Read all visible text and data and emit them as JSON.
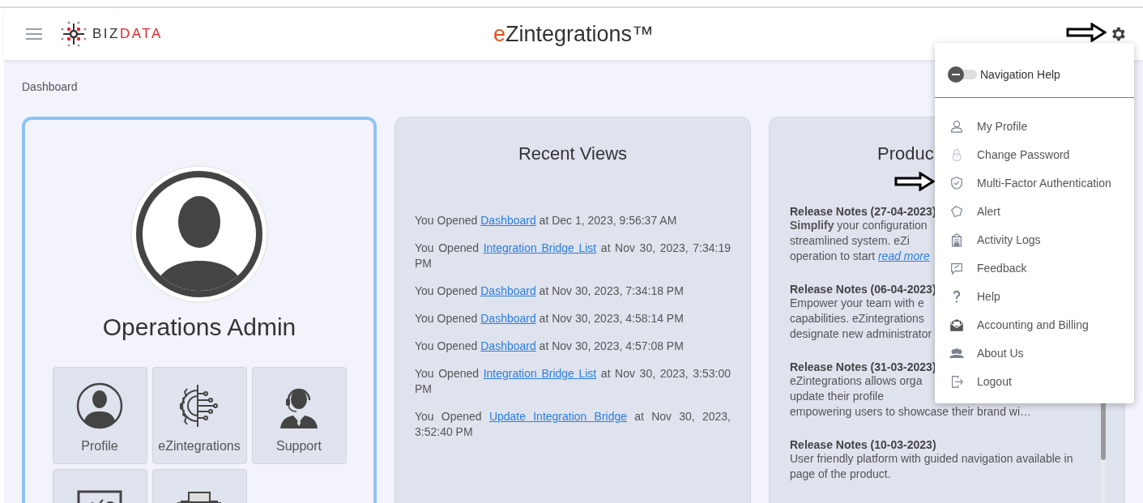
{
  "header": {
    "logo_text": "BIZDATA",
    "brand": "eZintegrations™"
  },
  "breadcrumb": "Dashboard",
  "profile_card": {
    "name": "Operations Admin",
    "tiles": [
      {
        "kind": "profile",
        "label": "Profile"
      },
      {
        "kind": "integrations",
        "label": "eZintegrations"
      },
      {
        "kind": "support",
        "label": "Support"
      },
      {
        "kind": "chart"
      },
      {
        "kind": "market"
      }
    ]
  },
  "recent_views": {
    "title": "Recent Views",
    "items": [
      {
        "prefix": "You Opened ",
        "link": "Dashboard",
        "suffix": " at Dec 1, 2023, 9:56:37 AM"
      },
      {
        "prefix": "You Opened ",
        "link": "Integration Bridge List",
        "suffix": " at Nov 30, 2023, 7:34:19 PM"
      },
      {
        "prefix": "You Opened ",
        "link": "Dashboard",
        "suffix": " at Nov 30, 2023, 7:34:18 PM"
      },
      {
        "prefix": "You Opened ",
        "link": "Dashboard",
        "suffix": " at Nov 30, 2023, 4:58:14 PM"
      },
      {
        "prefix": "You Opened ",
        "link": "Dashboard",
        "suffix": " at Nov 30, 2023, 4:57:08 PM"
      },
      {
        "prefix": "You Opened ",
        "link": "Integration Bridge List",
        "suffix": " at Nov 30, 2023, 3:53:00 PM"
      },
      {
        "prefix": "You Opened ",
        "link": "Update Integration Bridge",
        "suffix": " at Nov 30, 2023, 3:52:40 PM"
      }
    ]
  },
  "product_card": {
    "title": "Produc",
    "notes": [
      {
        "title": "Release Notes (27-04-2023)",
        "lines": [
          {
            "text": "**Simplify** your configuration"
          },
          {
            "text": "streamlined system. eZi"
          },
          {
            "text": "operation to start ",
            "link": "read more"
          }
        ]
      },
      {
        "title": "Release Notes (06-04-2023)",
        "lines": [
          {
            "text": "Empower your team with e"
          },
          {
            "text": "capabilities. eZintegrations"
          },
          {
            "text": "designate new administrator"
          }
        ]
      },
      {
        "title": "Release Notes (31-03-2023)",
        "lines": [
          {
            "text": "eZintegrations allows orga"
          },
          {
            "text": "update their profile"
          },
          {
            "text": "empowering users to showcase their brand wi…"
          }
        ]
      },
      {
        "title": "Release Notes (10-03-2023)",
        "lines": [
          {
            "text": "User friendly platform with guided navigation available in page of the product."
          }
        ]
      }
    ]
  },
  "settings_menu": {
    "navigation_help": {
      "label": "Navigation Help",
      "on": false
    },
    "items": [
      {
        "kind": "profile",
        "label": "My Profile"
      },
      {
        "kind": "lock",
        "label": "Change Password"
      },
      {
        "kind": "shield",
        "label": "Multi-Factor Authentication"
      },
      {
        "kind": "alert",
        "label": "Alert"
      },
      {
        "kind": "logs",
        "label": "Activity Logs"
      },
      {
        "kind": "feedback",
        "label": "Feedback"
      },
      {
        "kind": "help",
        "label": "Help"
      },
      {
        "kind": "billing",
        "label": "Accounting and Billing"
      },
      {
        "kind": "people",
        "label": "About Us"
      },
      {
        "kind": "logout",
        "label": "Logout"
      }
    ]
  }
}
